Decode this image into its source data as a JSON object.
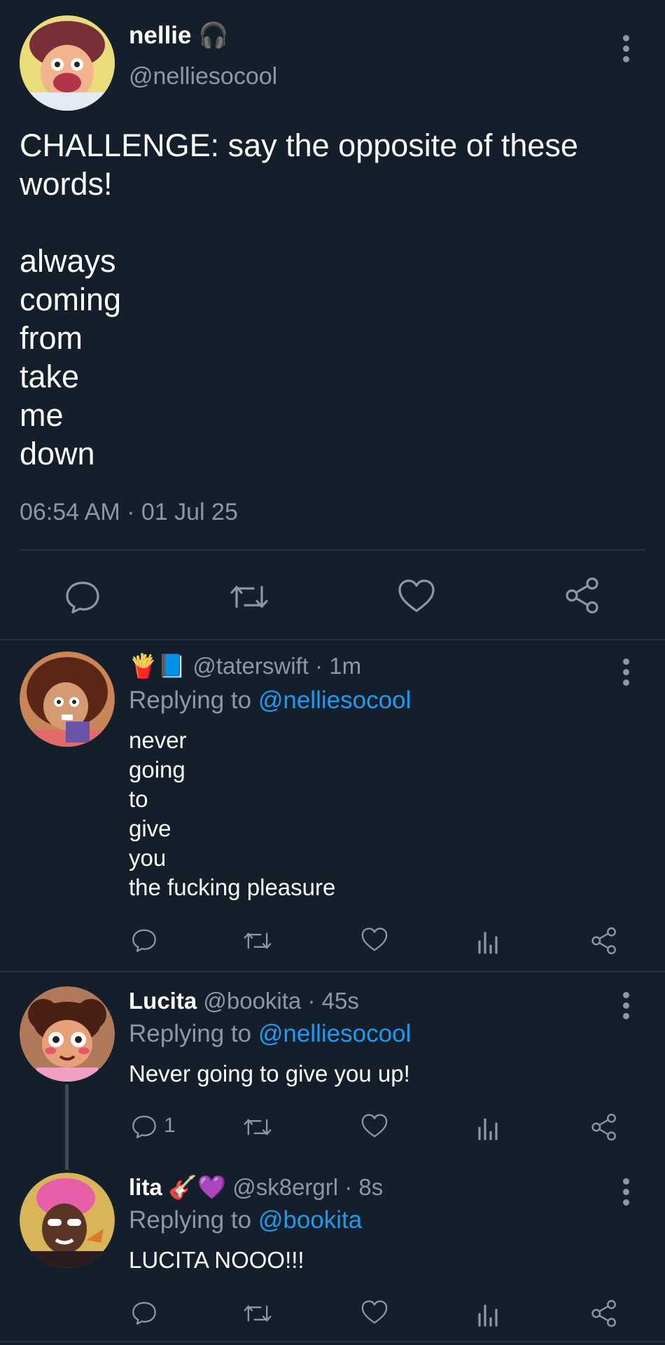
{
  "main_post": {
    "display_name": "nellie",
    "name_emoji": "🎧",
    "handle": "@nelliesocool",
    "text_lines": [
      "CHALLENGE: say the opposite of these",
      "words!",
      "",
      "always",
      "coming",
      "from",
      "take",
      "me",
      "down"
    ],
    "timestamp": "06:54 AM · 01 Jul 25",
    "actions": [
      "reply-icon",
      "retweet-icon",
      "like-icon",
      "share-icon"
    ]
  },
  "replies": [
    {
      "emoji": "🍟📘",
      "handle": "@taterswift",
      "time": "· 1m",
      "replying_prefix": "Replying to",
      "replying_to": "@nelliesocool",
      "text_lines": [
        "never",
        "going",
        "to",
        "give",
        "you",
        "the fucking pleasure"
      ],
      "reply_count": ""
    },
    {
      "display_name": "Lucita",
      "handle": "@bookita",
      "time": "· 45s",
      "replying_prefix": "Replying to",
      "replying_to": "@nelliesocool",
      "text_lines": [
        "Never going to give you up!"
      ],
      "reply_count": "1"
    },
    {
      "display_name": "lita",
      "name_emoji": "🎸💜",
      "handle": "@sk8ergrl",
      "time": "· 8s",
      "replying_prefix": "Replying to",
      "replying_to": "@bookita",
      "text_lines": [
        "LUCITA NOOO!!!"
      ],
      "reply_count": ""
    }
  ],
  "colors": {
    "background": "#151f2b",
    "muted": "#8b98a5",
    "link": "#1d9bf0",
    "divider": "#253341"
  }
}
